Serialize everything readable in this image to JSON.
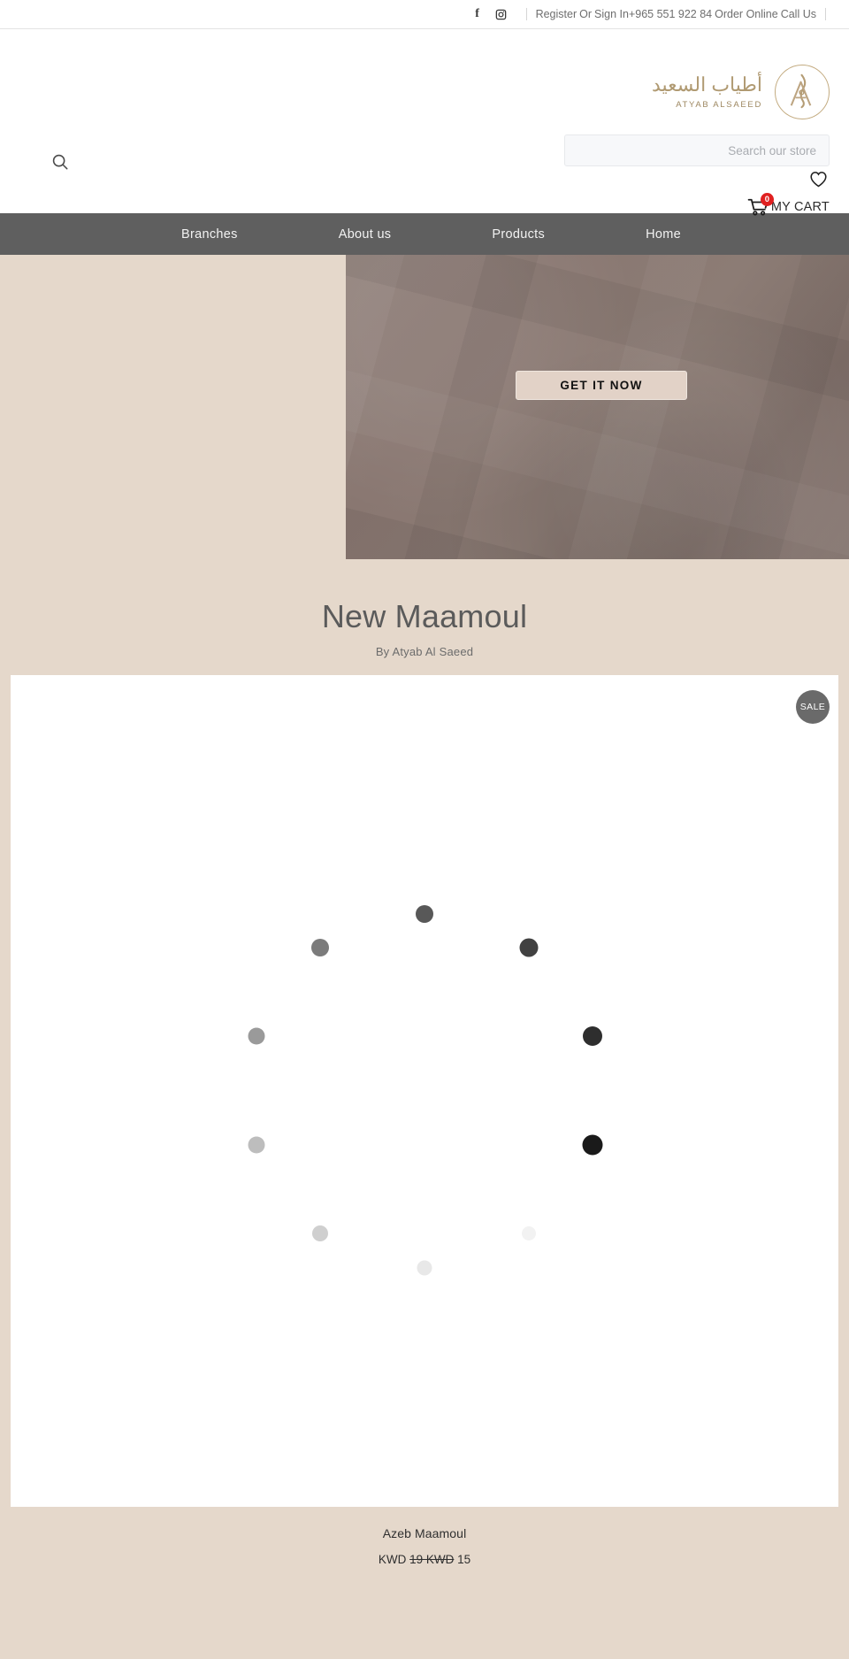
{
  "topbar": {
    "social": [
      {
        "name": "facebook-icon",
        "glyph": "f"
      },
      {
        "name": "instagram-icon",
        "glyph": "instagram"
      }
    ],
    "register": "Register",
    "or": "Or",
    "signin": "Sign In",
    "phone": "+965 551 922 84",
    "order_online": "Order Online",
    "call_us": "Call Us"
  },
  "header": {
    "search_icon": "search-icon",
    "logo": {
      "arabic": "أطياب السعيد",
      "english": "ATYAB ALSAEED",
      "monogram": "AS",
      "color": "#b09a72"
    },
    "search": {
      "placeholder": "Search our store",
      "value": ""
    },
    "wishlist_icon": "heart-icon",
    "cart": {
      "icon": "shopping-cart-icon",
      "count": "0",
      "label": "MY CART",
      "badge_color": "#e02020"
    }
  },
  "nav": {
    "background": "#5f5f5f",
    "items": [
      {
        "label": "Branches",
        "name": "nav-item-branches"
      },
      {
        "label": "About us",
        "name": "nav-item-about-us"
      },
      {
        "label": "Products",
        "name": "nav-item-products"
      },
      {
        "label": "Home",
        "name": "nav-item-home"
      }
    ]
  },
  "hero": {
    "cta_label": "GET IT NOW",
    "cta_bg": "#e2d2c7",
    "left_bg": "#e5d8cb",
    "image_tone": "#877873"
  },
  "section": {
    "title": "New Maamoul",
    "subtitle": "By Atyab Al Saeed"
  },
  "products": {
    "sale_badge": "SALE",
    "loading_spinner": "loading-spinner",
    "spinner_dots": [
      {
        "angle": 270,
        "shade": "#585858",
        "size": 20
      },
      {
        "angle": 306,
        "shade": "#414141",
        "size": 21
      },
      {
        "angle": 342,
        "shade": "#2e2e2e",
        "size": 22
      },
      {
        "angle": 18,
        "shade": "#1a1a1a",
        "size": 23
      },
      {
        "angle": 54,
        "shade": "#f2f2f2",
        "size": 16
      },
      {
        "angle": 90,
        "shade": "#e8e8e8",
        "size": 17
      },
      {
        "angle": 126,
        "shade": "#cfcfcf",
        "size": 18
      },
      {
        "angle": 162,
        "shade": "#bdbdbd",
        "size": 19
      },
      {
        "angle": 198,
        "shade": "#9a9a9a",
        "size": 19
      },
      {
        "angle": 234,
        "shade": "#7b7b7b",
        "size": 20
      }
    ],
    "items": [
      {
        "name": "Azeb Maamoul",
        "price_currency": "KWD",
        "price_old": "19 KWD",
        "price_new": "15"
      }
    ]
  }
}
